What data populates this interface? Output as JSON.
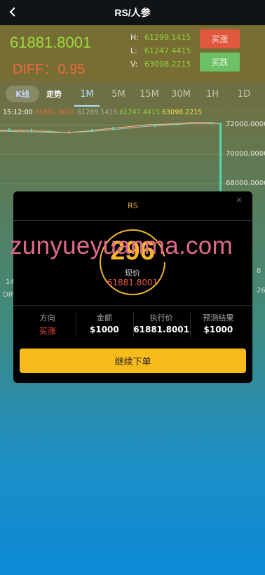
{
  "header": {
    "title": "RS/人参"
  },
  "quote": {
    "price": "61881.8001",
    "diff_text": "DIFF：0.95",
    "high_key": "H:",
    "high": "61299.1415",
    "low_key": "L:",
    "low": "61247.4415",
    "vol_key": "V:",
    "vol": "63098.2215"
  },
  "actions": {
    "buy_up": "买涨",
    "buy_down": "买跌"
  },
  "tabs": [
    "K线",
    "走势",
    "1M",
    "5M",
    "15M",
    "30M",
    "1H",
    "1D"
  ],
  "active_tab": "1M",
  "chart_info": {
    "time": "15:12:00",
    "open": "61881.8001",
    "high": "61289.1415",
    "low": "61247.4415",
    "vol": "63098.2215"
  },
  "chart_axis": [
    "72000.0000",
    "70000.0000",
    "68000.0000"
  ],
  "chart_side": {
    "left_num": "14",
    "left_diff": "DIF",
    "right_a": "26",
    "right_b": "8"
  },
  "modal": {
    "title": "RS",
    "countdown": "296",
    "now_label": "现价",
    "now_price": "61881.8001",
    "fields": [
      {
        "label": "方向",
        "value": "买涨"
      },
      {
        "label": "金额",
        "value": "$1000"
      },
      {
        "label": "执行价",
        "value": "61881.8001"
      },
      {
        "label": "预测结果",
        "value": "$1000"
      }
    ],
    "continue_label": "继续下单"
  },
  "watermark": "zunyueyuanma.com",
  "colors": {
    "accent_up": "#e0583e",
    "accent_down": "#6cc065",
    "gold": "#f8bb1c"
  }
}
